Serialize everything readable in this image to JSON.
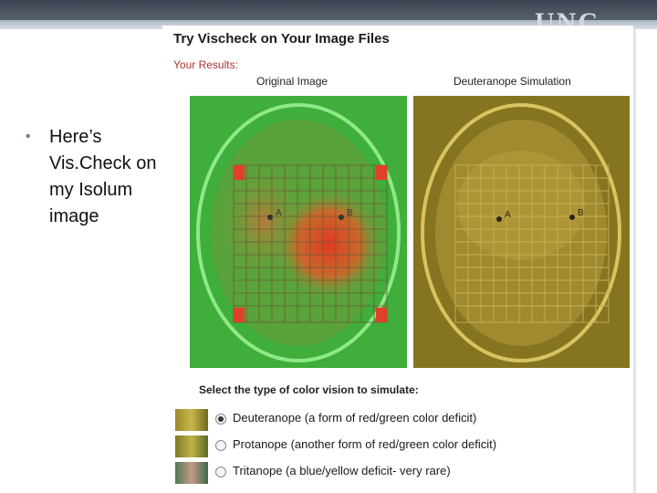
{
  "slide": {
    "watermark": "UNC",
    "bullet_lines": [
      "Here’s",
      "Vis.Check on",
      "my Isolum",
      "image"
    ]
  },
  "vischeck": {
    "title": "Try Vischeck on Your Image Files",
    "results_label": "Your Results:",
    "original_caption": "Original Image",
    "simulation_caption": "Deuteranope Simulation",
    "select_prompt": "Select the type of color vision to simulate:",
    "options": [
      {
        "label": "Deuteranope (a form of red/green color deficit)",
        "selected": true
      },
      {
        "label": "Protanope (another form of red/green color deficit)",
        "selected": false
      },
      {
        "label": "Tritanope (a blue/yellow deficit- very rare)",
        "selected": false
      }
    ],
    "grid_markers": [
      "A",
      "B"
    ]
  },
  "colors": {
    "original_bg": "#3da83a",
    "original_hot": "#e5452b",
    "simulation_bg": "#8a7a1e",
    "simulation_light": "#c8b24a"
  }
}
